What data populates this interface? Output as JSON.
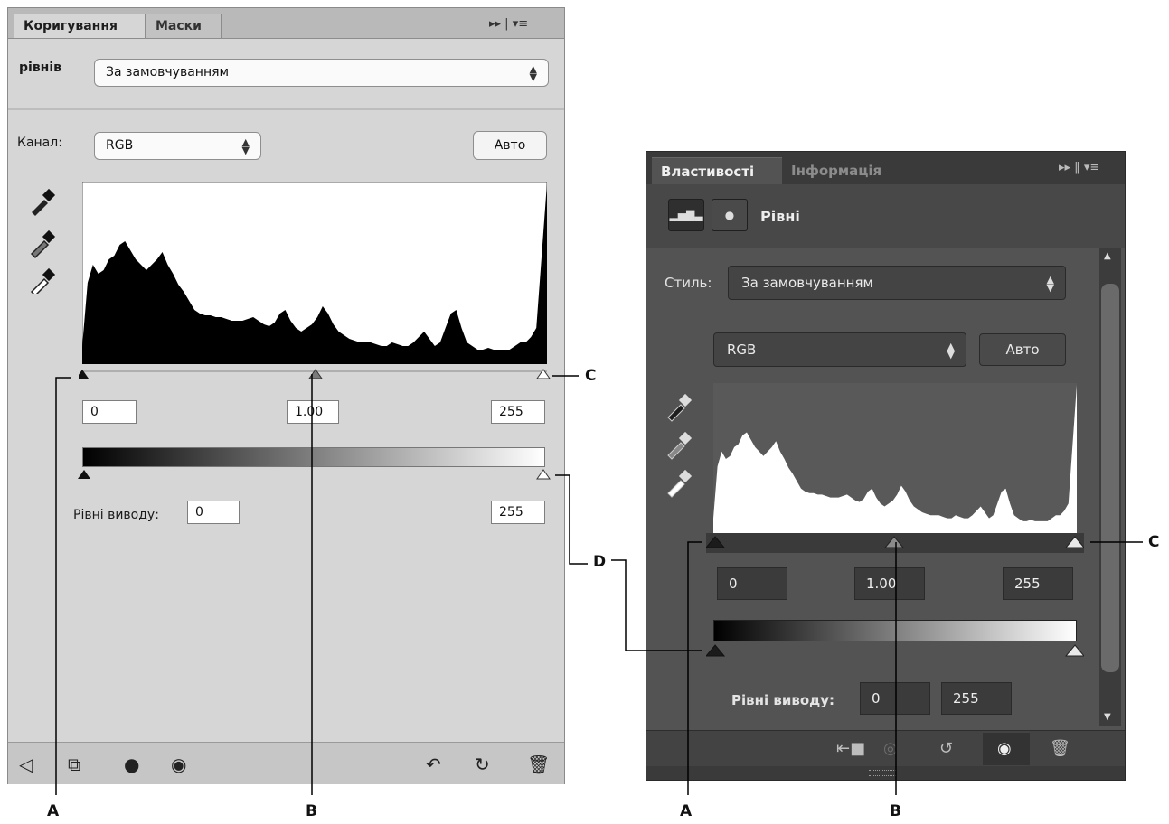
{
  "left_panel": {
    "tabs": [
      "Коригування",
      "Маски"
    ],
    "preset_label": "рівнів",
    "preset_value": "За замовчуванням",
    "channel_label": "Канал:",
    "channel_value": "RGB",
    "auto_button": "Авто",
    "input_black": "0",
    "input_gamma": "1.00",
    "input_white": "255",
    "output_label": "Рівні виводу:",
    "output_black": "0",
    "output_white": "255",
    "eyedroppers": [
      "black-point-eyedropper",
      "gray-point-eyedropper",
      "white-point-eyedropper"
    ],
    "menu_glyphs": "▸▸ | ▾≡"
  },
  "right_panel": {
    "tabs": [
      "Властивості",
      "Інформація"
    ],
    "title": "Рівні",
    "style_label": "Стиль:",
    "style_value": "За замовчуванням",
    "channel_value": "RGB",
    "auto_button": "Авто",
    "input_black": "0",
    "input_gamma": "1.00",
    "input_white": "255",
    "output_label": "Рівні виводу:",
    "output_black": "0",
    "output_white": "255",
    "menu_glyphs": "▸▸ ‖ ▾≡"
  },
  "callouts": {
    "left": {
      "a": "A",
      "b": "B",
      "c": "C",
      "d": "D"
    },
    "right": {
      "a": "A",
      "b": "B",
      "c": "C"
    }
  },
  "histogram": [
    0.1,
    0.45,
    0.55,
    0.5,
    0.52,
    0.58,
    0.6,
    0.66,
    0.68,
    0.63,
    0.58,
    0.55,
    0.52,
    0.55,
    0.58,
    0.62,
    0.55,
    0.5,
    0.44,
    0.4,
    0.35,
    0.3,
    0.28,
    0.27,
    0.27,
    0.26,
    0.26,
    0.25,
    0.24,
    0.24,
    0.24,
    0.25,
    0.26,
    0.24,
    0.22,
    0.21,
    0.23,
    0.28,
    0.3,
    0.24,
    0.2,
    0.18,
    0.2,
    0.22,
    0.26,
    0.32,
    0.28,
    0.22,
    0.18,
    0.16,
    0.14,
    0.13,
    0.12,
    0.12,
    0.12,
    0.11,
    0.1,
    0.1,
    0.12,
    0.11,
    0.1,
    0.1,
    0.12,
    0.15,
    0.18,
    0.14,
    0.1,
    0.12,
    0.2,
    0.28,
    0.3,
    0.2,
    0.12,
    0.1,
    0.08,
    0.08,
    0.09,
    0.08,
    0.08,
    0.08,
    0.08,
    0.1,
    0.12,
    0.12,
    0.15,
    0.2,
    0.6,
    1.0
  ],
  "colors": {
    "panel_light": "#d6d6d6",
    "panel_dark": "#535353",
    "histogram_light_bg": "#ffffff",
    "histogram_light_fill": "#000000",
    "histogram_dark_bg": "#595959",
    "histogram_dark_fill": "#ffffff"
  }
}
